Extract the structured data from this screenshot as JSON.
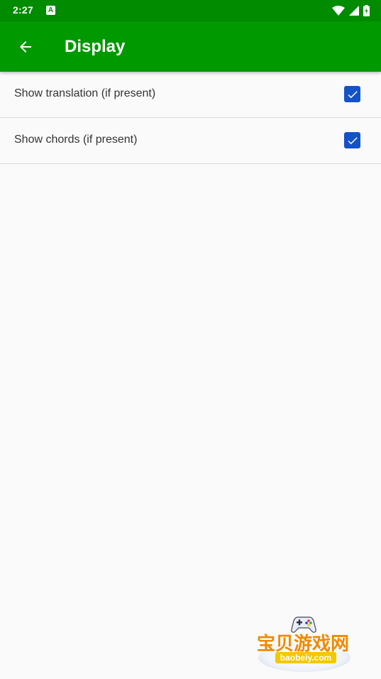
{
  "status_bar": {
    "time": "2:27",
    "app_icon_letter": "A",
    "icons": [
      "wifi-icon",
      "signal-icon",
      "battery-charging-icon"
    ]
  },
  "app_bar": {
    "title": "Display",
    "back_icon": "arrow-back-icon",
    "color": "#009900"
  },
  "preferences": [
    {
      "label": "Show translation (if present)",
      "checked": true
    },
    {
      "label": "Show chords (if present)",
      "checked": true
    }
  ],
  "watermark": {
    "text": "宝贝游戏网",
    "url": "baobeiy.com"
  },
  "colors": {
    "status_bar": "#008b00",
    "checkbox": "#1452c8",
    "background": "#fafafa"
  }
}
